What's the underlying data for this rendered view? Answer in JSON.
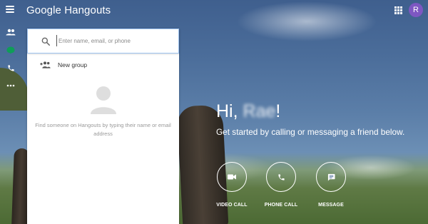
{
  "app": {
    "title": "Google Hangouts",
    "menu_icon": "hamburger-menu-icon",
    "apps_icon": "apps-grid-icon",
    "avatar_initial": "R",
    "avatar_color": "#7e57c2"
  },
  "rail": {
    "items": [
      {
        "icon": "contacts-icon",
        "color": "#ffffff"
      },
      {
        "icon": "conversations-icon",
        "color": "#0f9d58"
      },
      {
        "icon": "phone-icon",
        "color": "#ffffff"
      },
      {
        "icon": "more-icon",
        "color": "#ffffff"
      }
    ]
  },
  "panel": {
    "search": {
      "placeholder": "Enter name, email, or phone",
      "value": ""
    },
    "new_group_label": "New group",
    "empty_message": "Find someone on Hangouts by typing their name or email address"
  },
  "main": {
    "greeting_prefix": "Hi,",
    "greeting_name": "Rae",
    "greeting_suffix": "!",
    "subtitle": "Get started by calling or messaging a friend below.",
    "actions": [
      {
        "label": "VIDEO CALL",
        "icon": "video-camera-icon"
      },
      {
        "label": "PHONE CALL",
        "icon": "phone-icon"
      },
      {
        "label": "MESSAGE",
        "icon": "message-icon"
      }
    ]
  },
  "colors": {
    "accent_green": "#0f9d58",
    "search_border": "#9ec3f0"
  }
}
